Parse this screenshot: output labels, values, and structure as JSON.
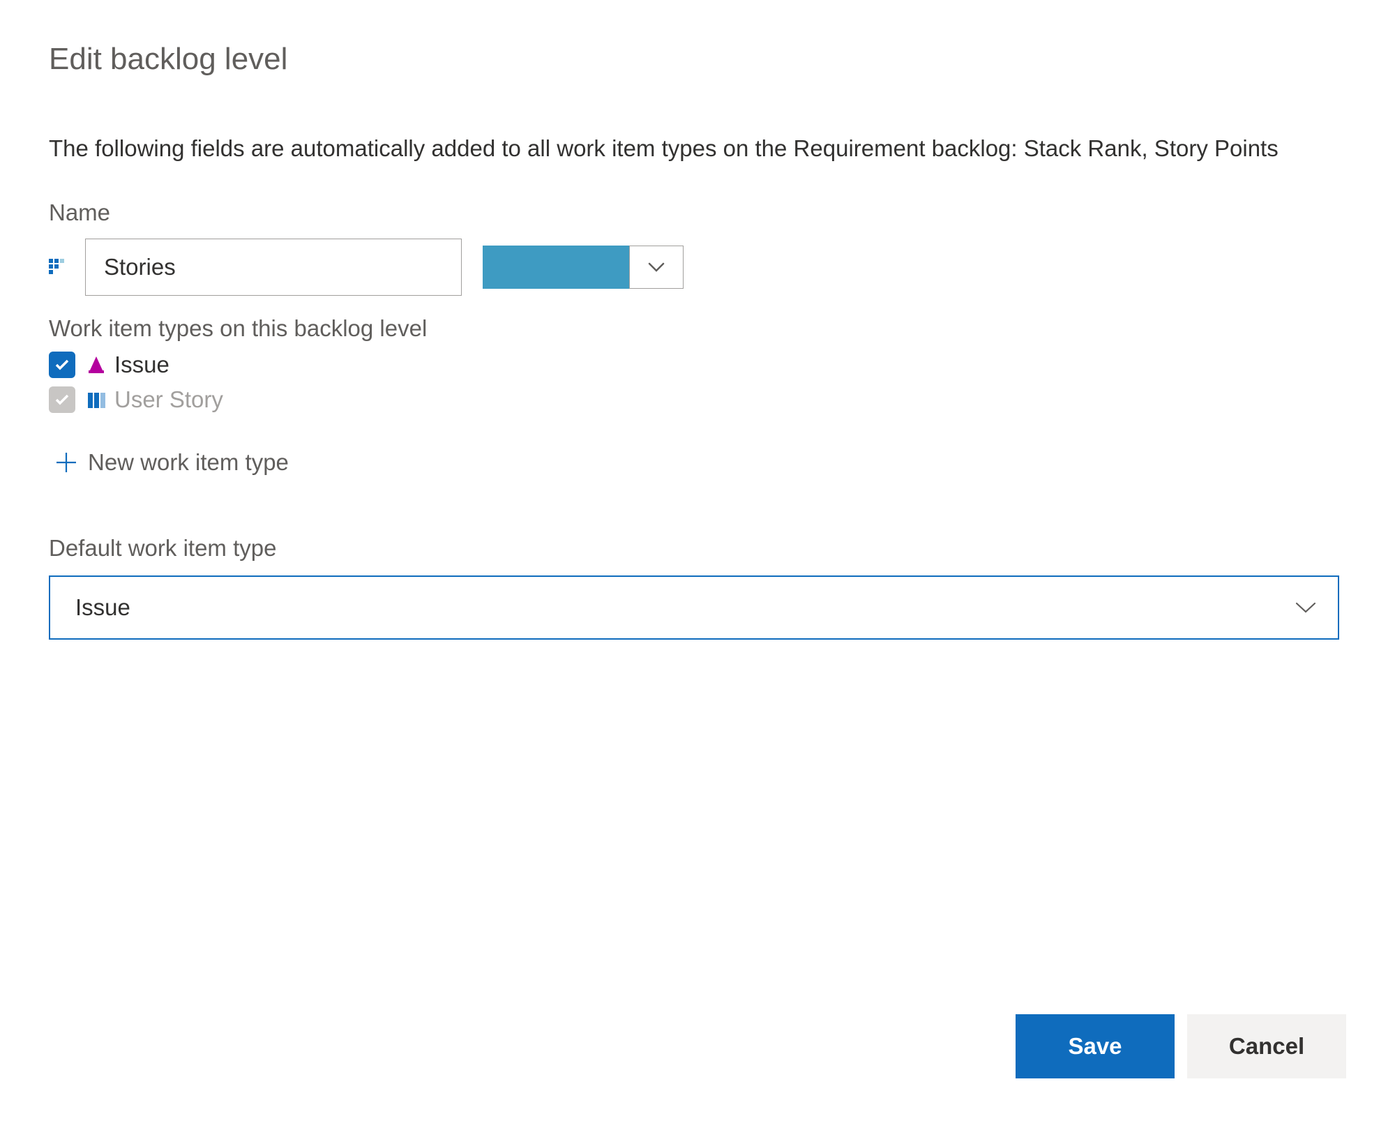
{
  "dialog": {
    "title": "Edit backlog level",
    "description": "The following fields are automatically added to all work item types on the Requirement backlog: Stack Rank, Story Points"
  },
  "name_section": {
    "label": "Name",
    "value": "Stories",
    "color": "#3e9bc2"
  },
  "wit_section": {
    "label": "Work item types on this backlog level",
    "items": [
      {
        "label": "Issue",
        "checked": true,
        "disabled": false,
        "icon": "issue-icon",
        "icon_color": "#b4009e"
      },
      {
        "label": "User Story",
        "checked": true,
        "disabled": true,
        "icon": "user-story-icon",
        "icon_color": "#0f6cbd"
      }
    ],
    "new_label": "New work item type"
  },
  "default_section": {
    "label": "Default work item type",
    "selected": "Issue"
  },
  "buttons": {
    "save": "Save",
    "cancel": "Cancel"
  }
}
